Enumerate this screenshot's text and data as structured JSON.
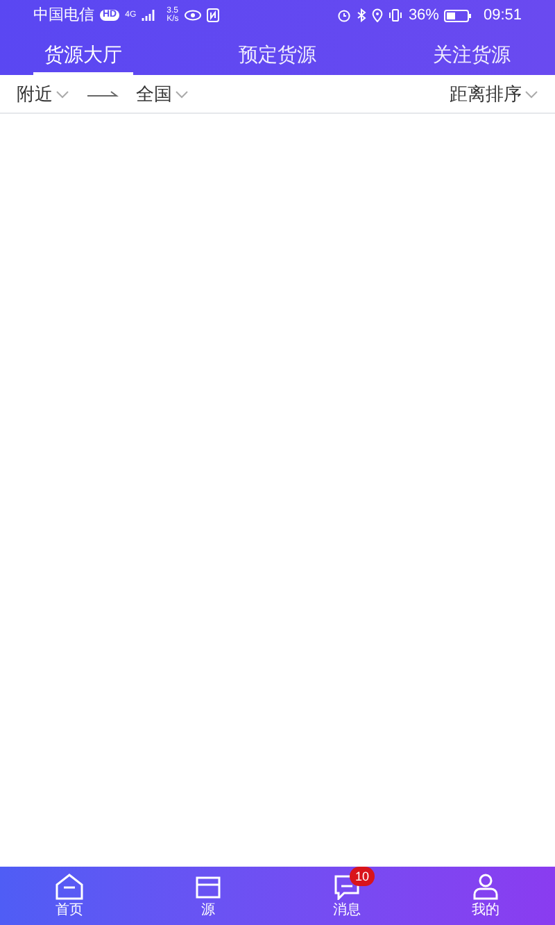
{
  "status_bar": {
    "carrier": "中国电信",
    "hd": "HD",
    "network": "4G",
    "speed": "3.5",
    "speed_unit": "K/s",
    "battery": "36%",
    "time": "09:51"
  },
  "tabs": [
    {
      "label": "货源大厅",
      "selected": true
    },
    {
      "label": "预定货源",
      "selected": false
    },
    {
      "label": "关注货源",
      "selected": false
    }
  ],
  "filters": {
    "from": "附近",
    "to": "全国",
    "sort": "距离排序"
  },
  "bottom_nav": [
    {
      "label": "首页",
      "kind": "home",
      "selected": false
    },
    {
      "label": "源",
      "kind": "cargo",
      "selected": false
    },
    {
      "label": "消息",
      "kind": "message",
      "badge": "10",
      "selected": false
    },
    {
      "label": "我的",
      "kind": "user",
      "selected": false
    }
  ]
}
